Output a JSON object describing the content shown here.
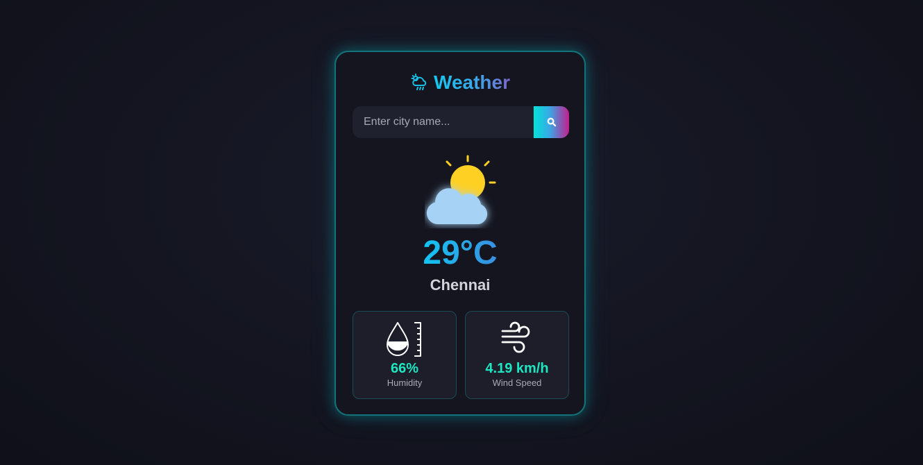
{
  "app": {
    "title": "Weather",
    "title_icon": "cloud-rain-icon"
  },
  "search": {
    "placeholder": "Enter city name...",
    "value": "",
    "button_icon": "search-icon"
  },
  "current": {
    "condition_icon": "partly-cloudy-icon",
    "temperature": "29°C",
    "city": "Chennai"
  },
  "stats": {
    "humidity": {
      "icon": "humidity-icon",
      "value": "66%",
      "label": "Humidity"
    },
    "wind": {
      "icon": "wind-icon",
      "value": "4.19 km/h",
      "label": "Wind Speed"
    }
  },
  "colors": {
    "accent_cyan": "#1de6c0",
    "border": "#127479",
    "sun": "#fdd023",
    "cloud": "#a6d3f5"
  }
}
